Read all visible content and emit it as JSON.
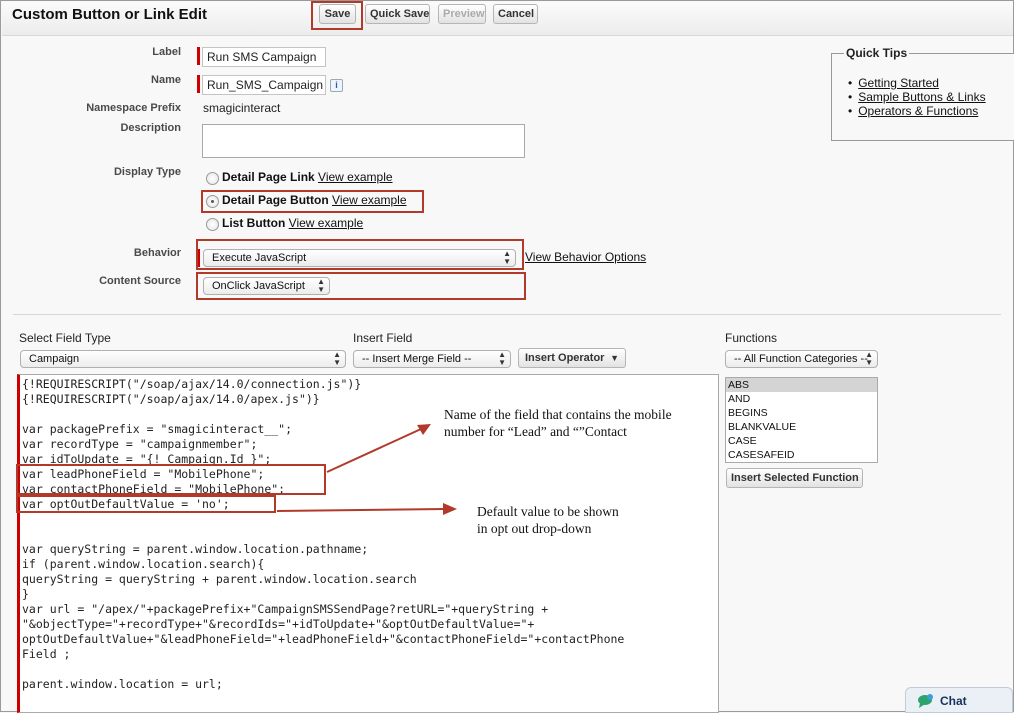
{
  "header": {
    "title": "Custom Button or Link Edit",
    "buttons": {
      "save": "Save",
      "quick_save": "Quick Save",
      "preview": "Preview",
      "cancel": "Cancel"
    }
  },
  "form": {
    "label": {
      "caption": "Label",
      "value": "Run SMS Campaign"
    },
    "name": {
      "caption": "Name",
      "value": "Run_SMS_Campaign",
      "info": "i"
    },
    "namespace": {
      "caption": "Namespace Prefix",
      "value": "smagicinteract"
    },
    "description": {
      "caption": "Description",
      "value": ""
    },
    "display_type": {
      "caption": "Display Type",
      "options": [
        {
          "label": "Detail Page Link",
          "link": "View example",
          "selected": false
        },
        {
          "label": "Detail Page Button",
          "link": "View example",
          "selected": true
        },
        {
          "label": "List Button",
          "link": "View example",
          "selected": false
        }
      ]
    },
    "behavior": {
      "caption": "Behavior",
      "value": "Execute JavaScript",
      "link": "View Behavior Options"
    },
    "content_source": {
      "caption": "Content Source",
      "value": "OnClick JavaScript"
    }
  },
  "quick_tips": {
    "title": "Quick Tips",
    "links": [
      "Getting Started",
      "Sample Buttons & Links",
      "Operators & Functions"
    ]
  },
  "editor_toolbar": {
    "field_type": {
      "caption": "Select Field Type",
      "value": "Campaign"
    },
    "insert_field": {
      "caption": "Insert Field",
      "value": "-- Insert Merge Field --"
    },
    "insert_operator": "Insert Operator",
    "functions": {
      "caption": "Functions",
      "value": "-- All Function Categories --"
    }
  },
  "functions_list": {
    "items": [
      "ABS",
      "AND",
      "BEGINS",
      "BLANKVALUE",
      "CASE",
      "CASESAFEID"
    ],
    "selected": "ABS",
    "insert_button": "Insert Selected Function"
  },
  "code_lines": [
    "{!REQUIRESCRIPT(\"/soap/ajax/14.0/connection.js\")}",
    "{!REQUIRESCRIPT(\"/soap/ajax/14.0/apex.js\")}",
    "",
    "var packagePrefix = \"smagicinteract__\";",
    "var recordType = \"campaignmember\";",
    "var idToUpdate = \"{! Campaign.Id }\";",
    "var leadPhoneField = \"MobilePhone\";",
    "var contactPhoneField = \"MobilePhone\";",
    "var optOutDefaultValue = 'no';",
    "",
    "var queryString = parent.window.location.pathname;",
    "if (parent.window.location.search){",
    "queryString = queryString + parent.window.location.search",
    "}",
    "var url = \"/apex/\"+packagePrefix+\"CampaignSMSSendPage?retURL=\"+queryString +",
    "\"&objectType=\"+recordType+\"&recordIds=\"+idToUpdate+\"&optOutDefaultValue=\"+",
    "optOutDefaultValue+\"&leadPhoneField=\"+leadPhoneField+\"&contactPhoneField=\"+contactPhone",
    "Field ;",
    "",
    "parent.window.location = url;"
  ],
  "annotations": {
    "phone_field_line1": "Name of the field that contains the mobile",
    "phone_field_line2": "number for “Lead” and “”Contact",
    "opt_out_line1": "Default value to be shown",
    "opt_out_line2": "in opt out drop-down"
  },
  "chat": {
    "label": "Chat"
  },
  "colors": {
    "highlight_box": "#b23a2a",
    "required_bar": "#cc0000"
  }
}
